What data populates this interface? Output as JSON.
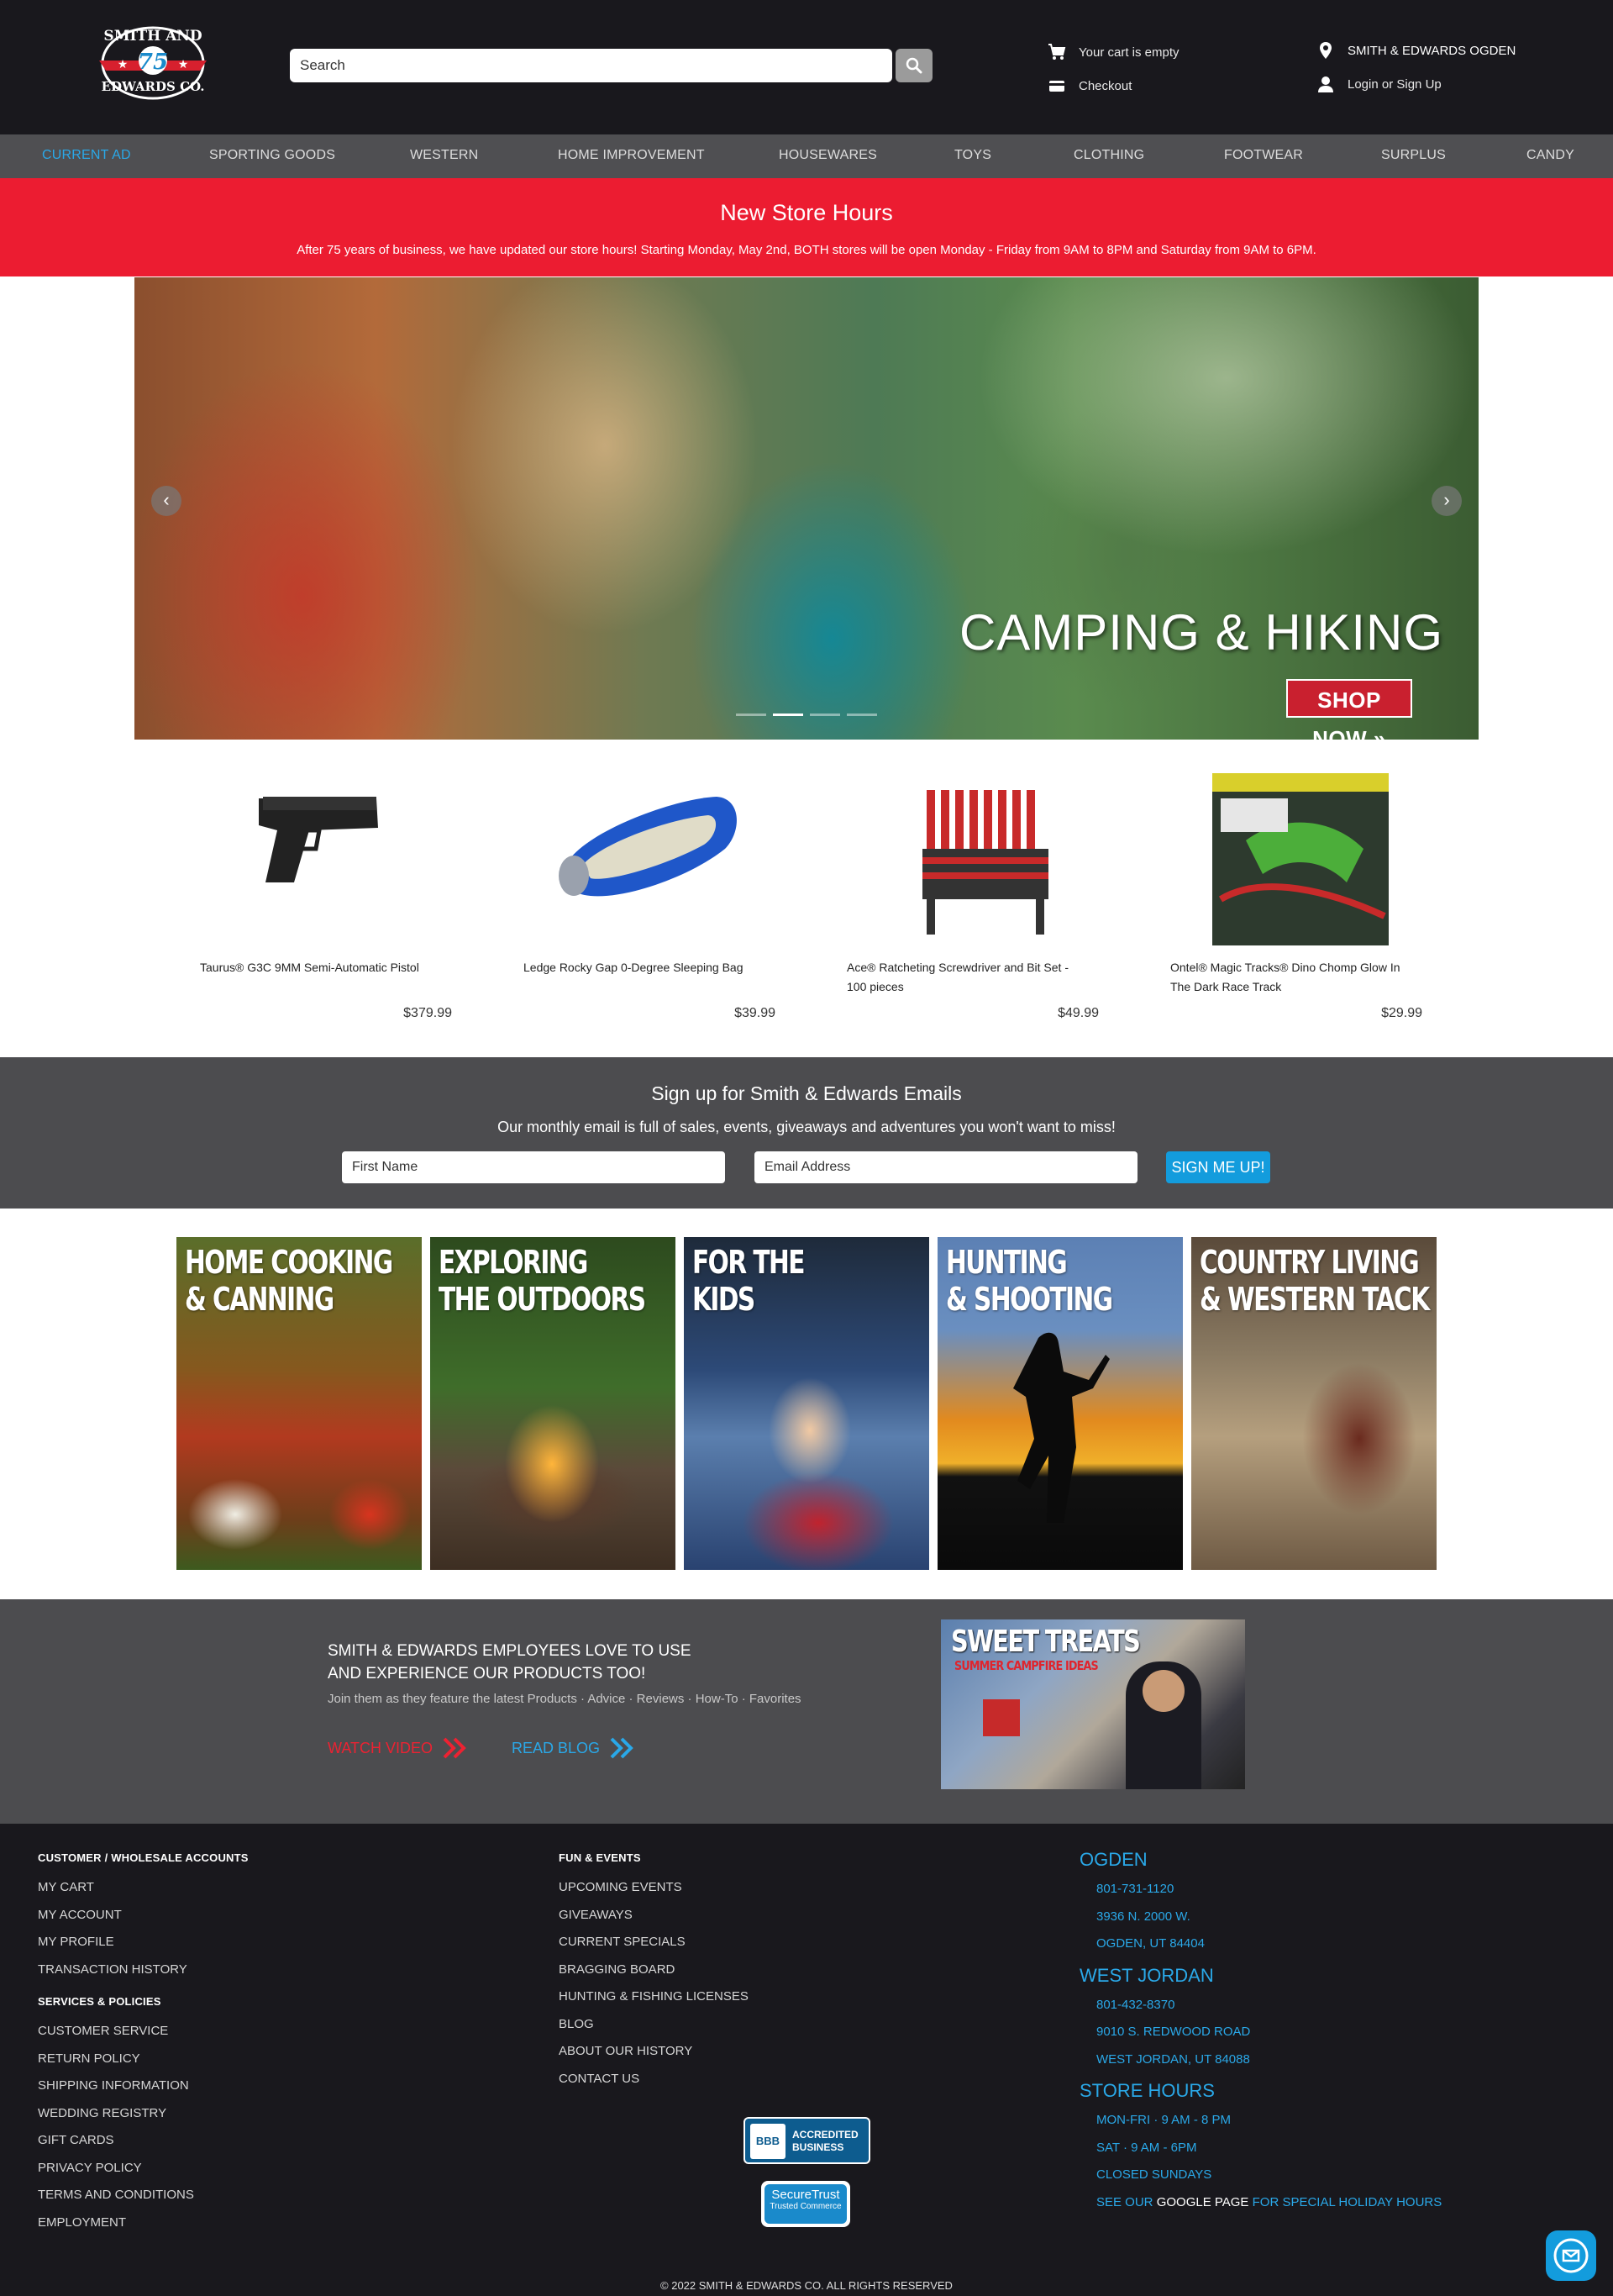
{
  "header": {
    "logo_text_top": "SMITH AND",
    "logo_number": "75",
    "logo_text_bottom": "EDWARDS CO.",
    "search_placeholder": "Search",
    "cart": "Your cart is empty",
    "checkout": "Checkout",
    "store": "SMITH & EDWARDS OGDEN",
    "login": "Login or Sign Up"
  },
  "nav": [
    "CURRENT AD",
    "SPORTING GOODS",
    "WESTERN",
    "HOME IMPROVEMENT",
    "HOUSEWARES",
    "TOYS",
    "CLOTHING",
    "FOOTWEAR",
    "SURPLUS",
    "CANDY"
  ],
  "banner": {
    "title": "New Store Hours",
    "text": "After 75 years of business, we have updated our store hours! Starting Monday, May 2nd, BOTH stores will be open Monday - Friday from 9AM to 8PM and Saturday from 9AM to 6PM."
  },
  "hero": {
    "title": "CAMPING & HIKING",
    "cta": "SHOP NOW »",
    "prev": "‹",
    "next": "›",
    "active_slide": 2,
    "slide_count": 4
  },
  "products": [
    {
      "name": "Taurus® G3C 9MM Semi-Automatic Pistol",
      "price": "$379.99",
      "icon": "pistol"
    },
    {
      "name": "Ledge Rocky Gap 0-Degree Sleeping Bag",
      "price": "$39.99",
      "icon": "sleeping-bag"
    },
    {
      "name": "Ace® Ratcheting Screwdriver and Bit Set - 100 pieces",
      "price": "$49.99",
      "icon": "screwdriver-set"
    },
    {
      "name": "Ontel® Magic Tracks® Dino Chomp Glow In The Dark Race Track",
      "price": "$29.99",
      "icon": "race-track-box"
    }
  ],
  "signup": {
    "title": "Sign up for Smith & Edwards Emails",
    "subtitle": "Our monthly email is full of sales, events, giveaways and adventures you won't want to miss!",
    "first_name_placeholder": "First Name",
    "email_placeholder": "Email Address",
    "button": "SIGN ME UP!"
  },
  "categories": [
    {
      "line1": "HOME COOKING",
      "line2": "& CANNING"
    },
    {
      "line1": "EXPLORING",
      "line2": "THE OUTDOORS"
    },
    {
      "line1": "FOR THE",
      "line2": "KIDS"
    },
    {
      "line1": "HUNTING",
      "line2": "& SHOOTING"
    },
    {
      "line1": "COUNTRY LIVING",
      "line2": "& WESTERN TACK"
    }
  ],
  "employees": {
    "title_line1": "SMITH & EDWARDS EMPLOYEES LOVE TO USE",
    "title_line2": "AND EXPERIENCE OUR PRODUCTS TOO!",
    "subtitle": "Join them as they feature the latest Products · Advice · Reviews · How-To · Favorites",
    "watch": "WATCH VIDEO",
    "read": "READ BLOG",
    "blog_title": "SWEET TREATS",
    "blog_subtitle": "SUMMER CAMPFIRE IDEAS"
  },
  "footer": {
    "col1_head1": "CUSTOMER / WHOLESALE ACCOUNTS",
    "col1_links1": [
      "MY CART",
      "MY ACCOUNT",
      "MY PROFILE",
      "TRANSACTION HISTORY"
    ],
    "col1_head2": "SERVICES & POLICIES",
    "col1_links2": [
      "CUSTOMER SERVICE",
      "RETURN POLICY",
      "SHIPPING INFORMATION",
      "WEDDING REGISTRY",
      "GIFT CARDS",
      "PRIVACY POLICY",
      "TERMS AND CONDITIONS",
      "EMPLOYMENT"
    ],
    "col2_head": "FUN & EVENTS",
    "col2_links": [
      "UPCOMING EVENTS",
      "GIVEAWAYS",
      "CURRENT SPECIALS",
      "BRAGGING BOARD",
      "HUNTING & FISHING LICENSES",
      "BLOG",
      "ABOUT OUR HISTORY",
      "CONTACT US"
    ],
    "ogden": {
      "head": "OGDEN",
      "phone": "801-731-1120",
      "street": "3936 N. 2000 W.",
      "city": "OGDEN, UT 84404"
    },
    "wj": {
      "head": "WEST JORDAN",
      "phone": "801-432-8370",
      "street": "9010 S. REDWOOD ROAD",
      "city": "WEST JORDAN, UT 84088"
    },
    "hours": {
      "head": "STORE HOURS",
      "l1": "MON-FRI · 9 AM - 8 PM",
      "l2": "SAT · 9 AM - 6PM",
      "l3": "CLOSED SUNDAYS",
      "l4a": "SEE OUR",
      "l4b": "GOOGLE PAGE",
      "l4c": "FOR SPECIAL HOLIDAY HOURS"
    },
    "bbb_logo": "BBB",
    "bbb_line1": "ACCREDITED",
    "bbb_line2": "BUSINESS",
    "secure_line1": "SecureTrust",
    "secure_line2": "Trusted Commerce",
    "copyright": "© 2022 SMITH & EDWARDS CO. ALL RIGHTS RESERVED"
  }
}
